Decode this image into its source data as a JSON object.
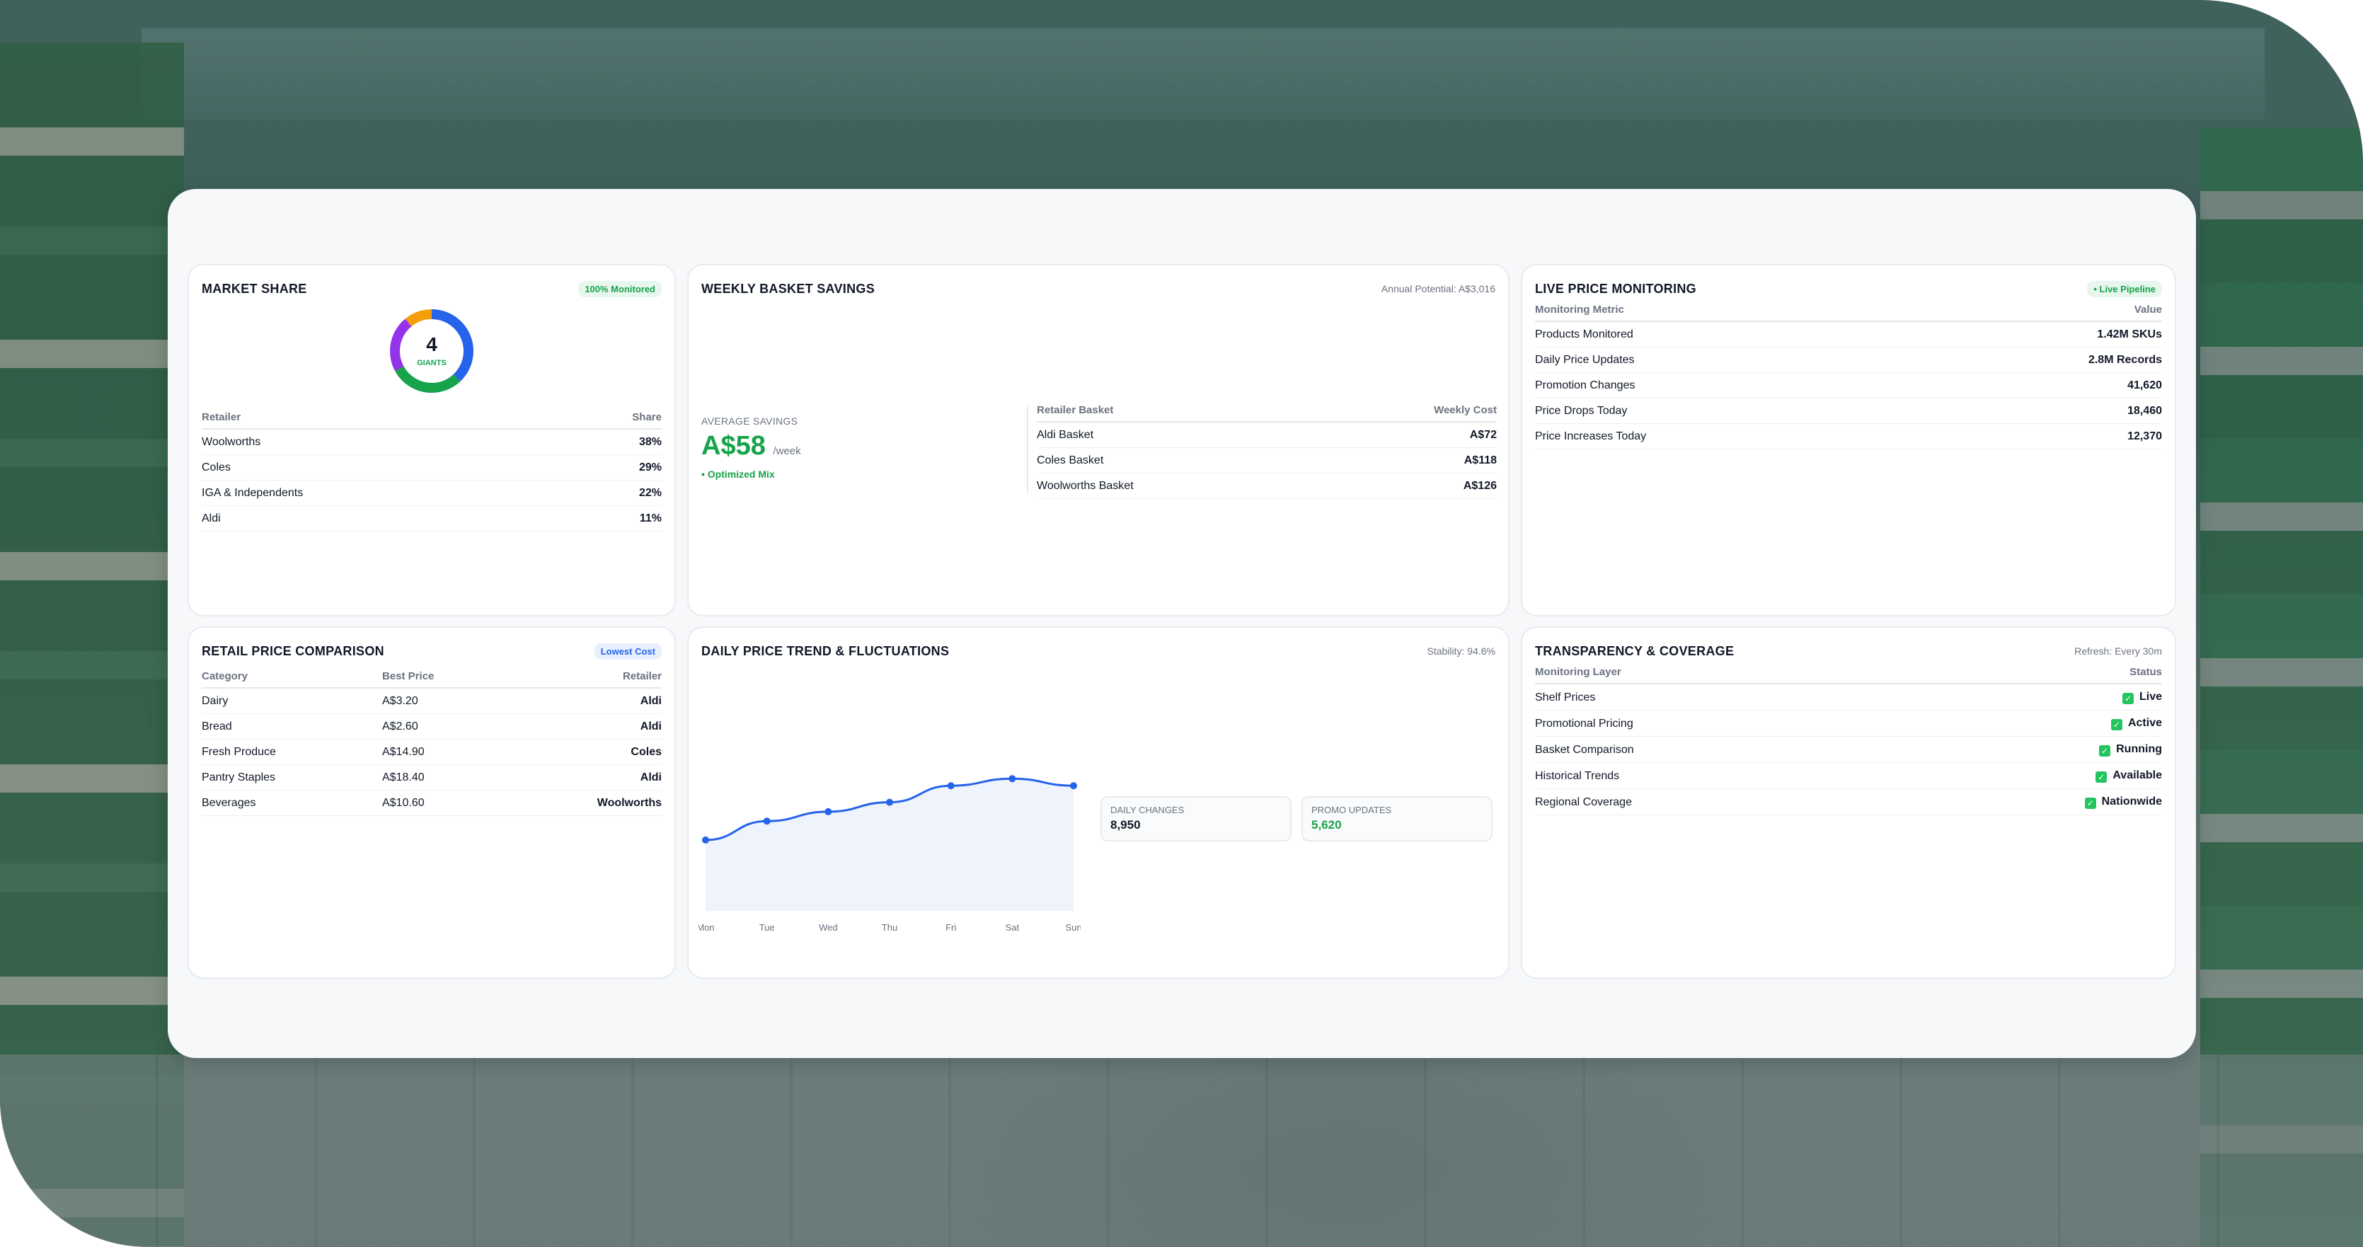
{
  "market_share": {
    "title": "MARKET SHARE",
    "badge": "100% Monitored",
    "donut_value": "4",
    "donut_label": "GIANTS",
    "headers": [
      "Retailer",
      "Share"
    ],
    "rows": [
      {
        "name": "Woolworths",
        "value": "38%",
        "color": "#2563eb"
      },
      {
        "name": "Coles",
        "value": "29%",
        "color": "#16a34a"
      },
      {
        "name": "IGA & Independents",
        "value": "22%",
        "color": "#9333ea"
      },
      {
        "name": "Aldi",
        "value": "11%",
        "color": "#f59e0b"
      }
    ]
  },
  "weekly_savings": {
    "title": "WEEKLY BASKET SAVINGS",
    "meta": "Annual Potential: A$3,016",
    "avg_label": "AVERAGE SAVINGS",
    "avg_value": "A$58",
    "avg_unit": "/week",
    "tag": "• Optimized Mix",
    "headers": [
      "Retailer Basket",
      "Weekly Cost"
    ],
    "rows": [
      {
        "name": "Aldi Basket",
        "value": "A$72"
      },
      {
        "name": "Coles Basket",
        "value": "A$118"
      },
      {
        "name": "Woolworths Basket",
        "value": "A$126"
      }
    ]
  },
  "live_monitoring": {
    "title": "LIVE PRICE MONITORING",
    "badge": "• Live Pipeline",
    "headers": [
      "Monitoring Metric",
      "Value"
    ],
    "rows": [
      {
        "name": "Products Monitored",
        "value": "1.42M SKUs"
      },
      {
        "name": "Daily Price Updates",
        "value": "2.8M Records"
      },
      {
        "name": "Promotion Changes",
        "value": "41,620"
      },
      {
        "name": "Price Drops Today",
        "value": "18,460"
      },
      {
        "name": "Price Increases Today",
        "value": "12,370"
      }
    ]
  },
  "price_comparison": {
    "title": "RETAIL PRICE COMPARISON",
    "badge": "Lowest Cost",
    "headers": [
      "Category",
      "Best Price",
      "Retailer"
    ],
    "rows": [
      {
        "category": "Dairy",
        "price": "A$3.20",
        "retailer": "Aldi"
      },
      {
        "category": "Bread",
        "price": "A$2.60",
        "retailer": "Aldi"
      },
      {
        "category": "Fresh Produce",
        "price": "A$14.90",
        "retailer": "Coles"
      },
      {
        "category": "Pantry Staples",
        "price": "A$18.40",
        "retailer": "Aldi"
      },
      {
        "category": "Beverages",
        "price": "A$10.60",
        "retailer": "Woolworths"
      }
    ]
  },
  "daily_trend": {
    "title": "DAILY PRICE TREND & FLUCTUATIONS",
    "meta": "Stability: 94.6%",
    "stats": [
      {
        "label": "DAILY CHANGES",
        "value": "8,950"
      },
      {
        "label": "PROMO UPDATES",
        "value": "5,620"
      }
    ]
  },
  "transparency": {
    "title": "TRANSPARENCY & COVERAGE",
    "meta": "Refresh: Every 30m",
    "headers": [
      "Monitoring Layer",
      "Status"
    ],
    "rows": [
      {
        "name": "Shelf Prices",
        "status": "Live"
      },
      {
        "name": "Promotional Pricing",
        "status": "Active"
      },
      {
        "name": "Basket Comparison",
        "status": "Running"
      },
      {
        "name": "Historical Trends",
        "status": "Available"
      },
      {
        "name": "Regional Coverage",
        "status": "Nationwide"
      }
    ]
  },
  "chart_data": {
    "type": "line",
    "categories": [
      "Mon",
      "Tue",
      "Wed",
      "Thu",
      "Fri",
      "Sat",
      "Sun"
    ],
    "series": [
      {
        "values": [
          42,
          50,
          54,
          58,
          65,
          68,
          65
        ]
      }
    ],
    "ylim": [
      0,
      100
    ],
    "grid": false,
    "color": "#2563eb"
  },
  "colors": {
    "blue": "#2563eb",
    "green": "#16a34a",
    "purple": "#9333ea",
    "orange": "#f59e0b"
  }
}
